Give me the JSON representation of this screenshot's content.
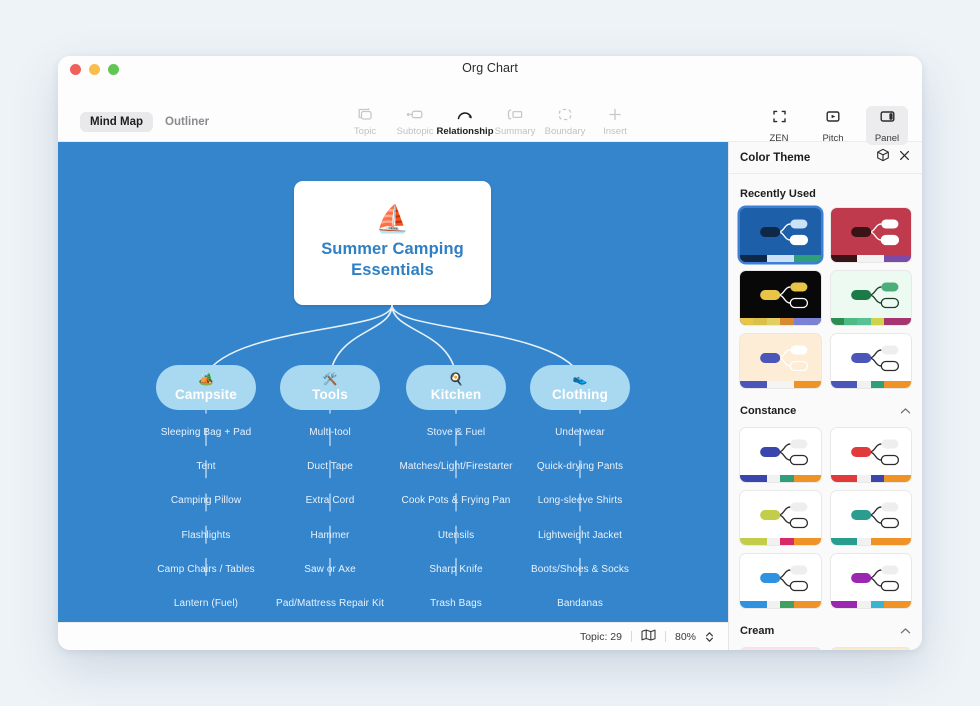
{
  "window": {
    "title": "Org Chart"
  },
  "traffic_lights": {
    "close": "close-button",
    "minimize": "minimize-button",
    "zoom": "zoom-button"
  },
  "toolbar": {
    "modes": [
      {
        "label": "Mind Map",
        "active": true
      },
      {
        "label": "Outliner",
        "active": false
      }
    ],
    "tools": [
      {
        "label": "Topic",
        "icon": "topic-icon",
        "enabled": false
      },
      {
        "label": "Subtopic",
        "icon": "subtopic-icon",
        "enabled": false
      },
      {
        "label": "Relationship",
        "icon": "relationship-icon",
        "enabled": true
      },
      {
        "label": "Summary",
        "icon": "summary-icon",
        "enabled": false
      },
      {
        "label": "Boundary",
        "icon": "boundary-icon",
        "enabled": false
      },
      {
        "label": "Insert",
        "icon": "plus-icon",
        "enabled": false
      }
    ],
    "right_tools": [
      {
        "label": "ZEN",
        "icon": "zen-icon",
        "active": false
      },
      {
        "label": "Pitch",
        "icon": "pitch-icon",
        "active": false
      },
      {
        "label": "Panel",
        "icon": "panel-icon",
        "active": true
      }
    ]
  },
  "canvas": {
    "background": "#3585cd",
    "root": {
      "label": "Summer Camping Essentials",
      "emoji": "⛵",
      "text_color": "#2f7fc4"
    },
    "branches": [
      {
        "label": "Campsite",
        "emoji": "🏕️",
        "pill_color": "#a9d8f1",
        "children": [
          "Sleeping Bag + Pad",
          "Tent",
          "Camping Pillow",
          "Flashlights",
          "Camp Chairs / Tables",
          "Lantern (Fuel)"
        ]
      },
      {
        "label": "Tools",
        "emoji": "🛠️",
        "pill_color": "#a9d8f1",
        "children": [
          "Multi-tool",
          "Duct Tape",
          "Extra Cord",
          "Hammer",
          "Saw or Axe",
          "Pad/Mattress Repair Kit"
        ]
      },
      {
        "label": "Kitchen",
        "emoji": "🍳",
        "pill_color": "#a9d8f1",
        "children": [
          "Stove & Fuel",
          "Matches/Light/Firestarter",
          "Cook Pots & Frying Pan",
          "Utensils",
          "Sharp Knife",
          "Trash Bags"
        ]
      },
      {
        "label": "Clothing",
        "emoji": "👟",
        "pill_color": "#a9d8f1",
        "children": [
          "Underwear",
          "Quick-drying Pants",
          "Long-sleeve Shirts",
          "Lightweight Jacket",
          "Boots/Shoes & Socks",
          "Bandanas"
        ]
      }
    ]
  },
  "statusbar": {
    "topic_count": "Topic: 29",
    "map_icon": "map-icon",
    "zoom_level": "80%"
  },
  "panel": {
    "title": "Color Theme",
    "cube_icon": "cube-icon",
    "close_icon": "close-icon",
    "sections": [
      {
        "title": "Recently Used",
        "collapsible": false,
        "themes": [
          {
            "name": "theme-blue",
            "selected": true,
            "bg": "#1d5fa8",
            "node": "#0f2847",
            "node_text": "#ffffff",
            "sub1": "#c9e2f7",
            "sub2": "#ffffff",
            "stroke": "#ffffff",
            "swatches": [
              "#0f2847",
              "#0f2847",
              "#c9e2f7",
              "#c9e2f7",
              "#2f9e7a",
              "#2f9e7a"
            ]
          },
          {
            "name": "theme-crimson",
            "selected": false,
            "bg": "#bf3a4c",
            "node": "#3a1317",
            "node_text": "#ffffff",
            "sub1": "#ffffff",
            "sub2": "#ffffff",
            "stroke": "#ffffff",
            "swatches": [
              "#3a1317",
              "#3a1317",
              "#f2f2f2",
              "#f2f2f2",
              "#7d4aa6",
              "#7d4aa6"
            ]
          },
          {
            "name": "theme-black-gold",
            "selected": false,
            "bg": "#080808",
            "node": "#e8c547",
            "node_text": "#000000",
            "sub1": "#e8c547",
            "sub2": "#080808",
            "stroke": "#ffffff",
            "swatches": [
              "#e8c547",
              "#d8c04a",
              "#e0cf62",
              "#d9892f",
              "#7b82d6",
              "#7b82d6"
            ]
          },
          {
            "name": "theme-mint",
            "selected": false,
            "bg": "#edfaf2",
            "node": "#1c7a46",
            "node_text": "#ffffff",
            "sub1": "#4cae78",
            "sub2": "#edfaf2",
            "stroke": "#1c3d28",
            "swatches": [
              "#2f8d53",
              "#4cbb84",
              "#58c195",
              "#cfd24a",
              "#a5356f",
              "#a5356f"
            ]
          },
          {
            "name": "theme-peach",
            "selected": false,
            "bg": "#fdecd6",
            "node": "#4b56b8",
            "node_text": "#ffffff",
            "sub1": "#ffffff",
            "sub2": "#fdecd6",
            "stroke": "#ffffff",
            "swatches": [
              "#4b56b8",
              "#4b56b8",
              "#f4f4f4",
              "#f4f4f4",
              "#ef9327",
              "#ef9327"
            ]
          },
          {
            "name": "theme-white-indigo",
            "selected": false,
            "bg": "#ffffff",
            "node": "#4b56b8",
            "node_text": "#ffffff",
            "sub1": "#eeeeee",
            "sub2": "#ffffff",
            "stroke": "#2c2c2c",
            "swatches": [
              "#4b56b8",
              "#4b56b8",
              "#f1f1f1",
              "#2f9e7a",
              "#ef9327",
              "#ef9327"
            ]
          }
        ]
      },
      {
        "title": "Constance",
        "collapsible": true,
        "themes": [
          {
            "name": "theme-constance-indigo",
            "selected": false,
            "bg": "#ffffff",
            "node": "#3b46ad",
            "node_text": "#ffffff",
            "sub1": "#eeeeee",
            "sub2": "#ffffff",
            "stroke": "#2c2c2c",
            "swatches": [
              "#3b46ad",
              "#3b46ad",
              "#f1f1f1",
              "#2f9e7a",
              "#ef9327",
              "#ef9327"
            ]
          },
          {
            "name": "theme-constance-red",
            "selected": false,
            "bg": "#ffffff",
            "node": "#e03a3a",
            "node_text": "#ffffff",
            "sub1": "#eeeeee",
            "sub2": "#ffffff",
            "stroke": "#2c2c2c",
            "swatches": [
              "#e03a3a",
              "#e03a3a",
              "#f1f1f1",
              "#3b46ad",
              "#ef9327",
              "#ef9327"
            ]
          },
          {
            "name": "theme-constance-olive",
            "selected": false,
            "bg": "#ffffff",
            "node": "#c3cd4a",
            "node_text": "#ffffff",
            "sub1": "#eeeeee",
            "sub2": "#ffffff",
            "stroke": "#2c2c2c",
            "swatches": [
              "#c3cd4a",
              "#c3cd4a",
              "#f1f1f1",
              "#d8296b",
              "#ef9327",
              "#ef9327"
            ]
          },
          {
            "name": "theme-constance-teal",
            "selected": false,
            "bg": "#ffffff",
            "node": "#2a9d8f",
            "node_text": "#ffffff",
            "sub1": "#eeeeee",
            "sub2": "#ffffff",
            "stroke": "#2c2c2c",
            "swatches": [
              "#2a9d8f",
              "#2a9d8f",
              "#f1f1f1",
              "#ef9327",
              "#ef9327",
              "#ef9327"
            ]
          },
          {
            "name": "theme-constance-blue",
            "selected": false,
            "bg": "#ffffff",
            "node": "#2f92e0",
            "node_text": "#ffffff",
            "sub1": "#eeeeee",
            "sub2": "#ffffff",
            "stroke": "#2c2c2c",
            "swatches": [
              "#2f92e0",
              "#2f92e0",
              "#f1f1f1",
              "#40a060",
              "#ef9327",
              "#ef9327"
            ]
          },
          {
            "name": "theme-constance-purple",
            "selected": false,
            "bg": "#ffffff",
            "node": "#9b27b0",
            "node_text": "#ffffff",
            "sub1": "#eeeeee",
            "sub2": "#ffffff",
            "stroke": "#2c2c2c",
            "swatches": [
              "#9b27b0",
              "#9b27b0",
              "#f1f1f1",
              "#3ab5cf",
              "#ef9327",
              "#ef9327"
            ]
          }
        ]
      },
      {
        "title": "Cream",
        "collapsible": true,
        "themes": [
          {
            "name": "theme-cream-pink",
            "selected": false,
            "bg": "#fbe3e9",
            "node": "#3f9ae8",
            "node_text": "#ffffff",
            "sub1": "#ffffff",
            "sub2": "#fbe3e9",
            "stroke": "#ffffff",
            "swatches": [
              "#3f9ae8",
              "#3f9ae8",
              "#f7f7f7",
              "#f7f7f7",
              "#ef9327",
              "#ef9327"
            ]
          },
          {
            "name": "theme-cream-peach",
            "selected": false,
            "bg": "#fdeacc",
            "node": "#3b46ad",
            "node_text": "#ffffff",
            "sub1": "#ffffff",
            "sub2": "#fdeacc",
            "stroke": "#ffffff",
            "swatches": [
              "#3b46ad",
              "#3b46ad",
              "#f7f7f7",
              "#f7f7f7",
              "#ef9327",
              "#ef9327"
            ]
          }
        ]
      }
    ]
  }
}
